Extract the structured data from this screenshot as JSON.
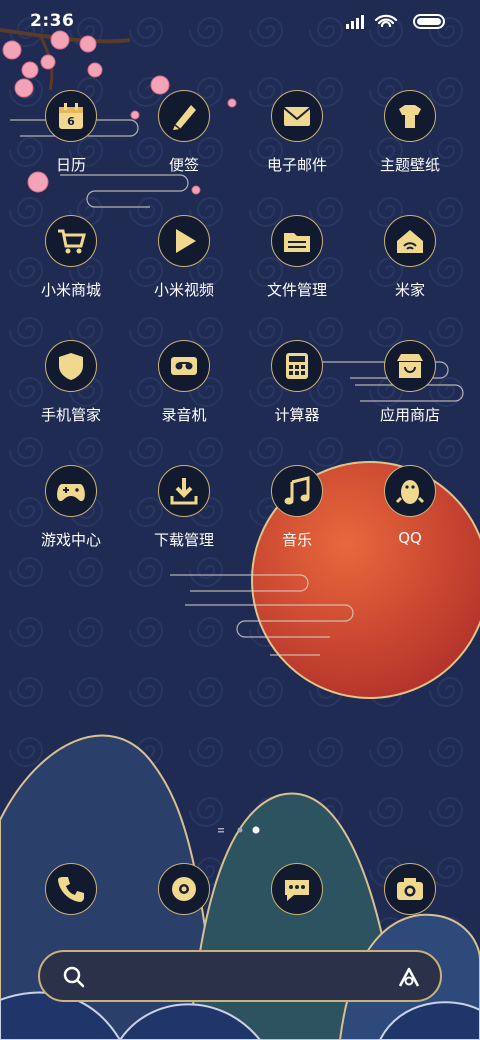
{
  "status_bar": {
    "time": "2:36"
  },
  "apps": [
    {
      "label": "日历",
      "icon": "calendar-icon",
      "badge": "6"
    },
    {
      "label": "便签",
      "icon": "notes-icon"
    },
    {
      "label": "电子邮件",
      "icon": "email-icon"
    },
    {
      "label": "主题壁纸",
      "icon": "themes-icon"
    },
    {
      "label": "小米商城",
      "icon": "shopping-cart-icon"
    },
    {
      "label": "小米视频",
      "icon": "video-play-icon"
    },
    {
      "label": "文件管理",
      "icon": "folder-icon"
    },
    {
      "label": "米家",
      "icon": "smart-home-icon"
    },
    {
      "label": "手机管家",
      "icon": "security-icon"
    },
    {
      "label": "录音机",
      "icon": "recorder-icon"
    },
    {
      "label": "计算器",
      "icon": "calculator-icon"
    },
    {
      "label": "应用商店",
      "icon": "app-store-icon"
    },
    {
      "label": "游戏中心",
      "icon": "gamepad-icon"
    },
    {
      "label": "下载管理",
      "icon": "download-icon"
    },
    {
      "label": "音乐",
      "icon": "music-icon"
    },
    {
      "label": "QQ",
      "icon": "qq-penguin-icon"
    }
  ],
  "dock": [
    {
      "icon": "phone-icon"
    },
    {
      "icon": "browser-icon"
    },
    {
      "icon": "messages-icon"
    },
    {
      "icon": "camera-icon"
    }
  ],
  "colors": {
    "background": "#1f2b52",
    "sun": "#c8402e",
    "icon_border": "#c9b37a",
    "blossom": "#f2a3b5"
  }
}
